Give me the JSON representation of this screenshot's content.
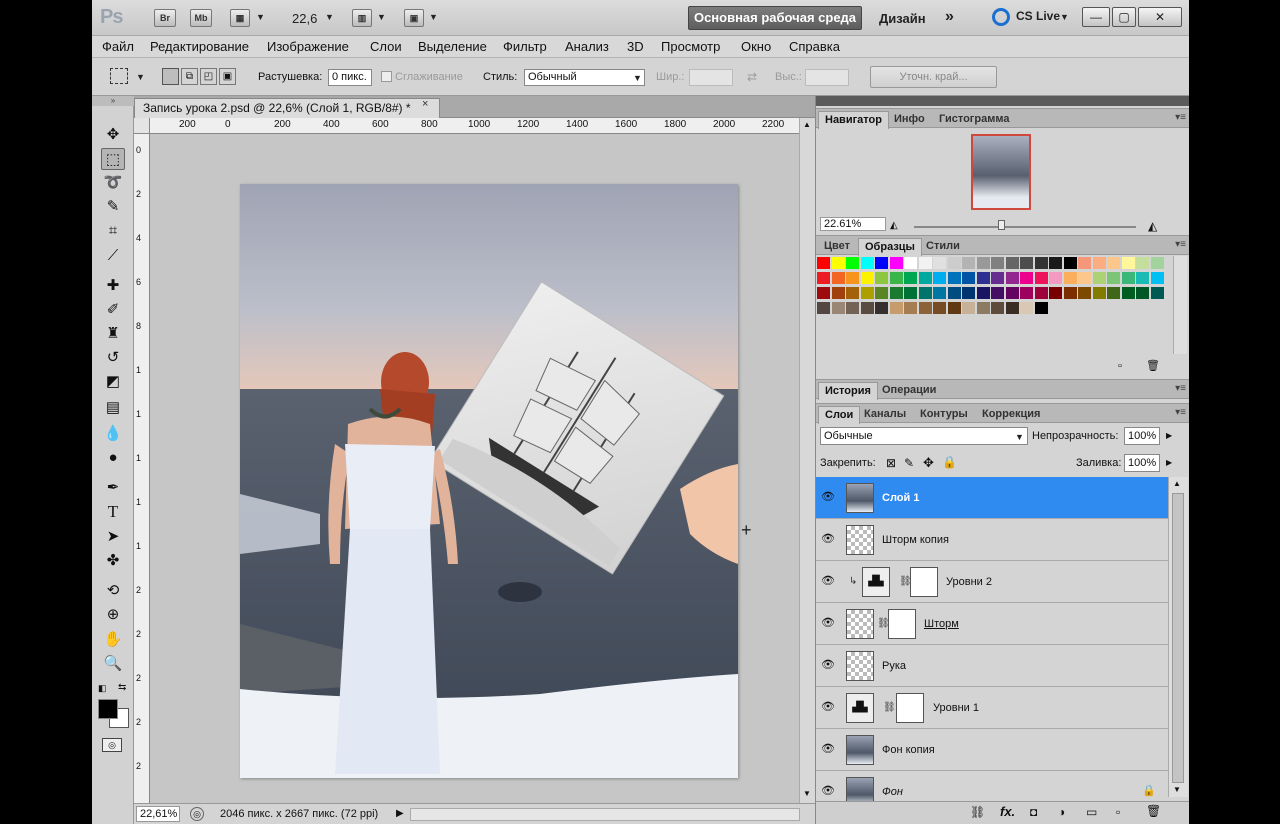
{
  "app": {
    "logo": "Ps",
    "bridge": "Br",
    "minibridge": "Mb",
    "zoom_value": "22,6",
    "workspace_active": "Основная рабочая среда",
    "workspace_design": "Дизайн",
    "workspace_more": "»",
    "cs_live": "CS Live",
    "win_min": "—",
    "win_max": "▢",
    "win_close": "✕"
  },
  "menu": [
    "Файл",
    "Редактирование",
    "Изображение",
    "Слои",
    "Выделение",
    "Фильтр",
    "Анализ",
    "3D",
    "Просмотр",
    "Окно",
    "Справка"
  ],
  "options": {
    "feather_label": "Растушевка:",
    "feather_value": "0 пикс.",
    "antialias_label": "Сглаживание",
    "style_label": "Стиль:",
    "style_value": "Обычный",
    "width_label": "Шир.:",
    "height_label": "Выс.:",
    "refine_edge": "Уточн. край..."
  },
  "document": {
    "tab_title": "Запись урока 2.psd @ 22,6% (Слой 1, RGB/8#) *",
    "tab_close": "×",
    "ruler_h": [
      "200",
      "0",
      "200",
      "400",
      "600",
      "800",
      "1000",
      "1200",
      "1400",
      "1600",
      "1800",
      "2000",
      "2200"
    ],
    "ruler_v": [
      "0",
      "2",
      "4",
      "6",
      "8",
      "1",
      "1",
      "1",
      "1",
      "1",
      "2",
      "2",
      "2",
      "2",
      "2"
    ]
  },
  "status": {
    "zoom": "22,61%",
    "info": "2046 пикс. x 2667 пикс. (72 ppi)"
  },
  "panels": {
    "nav_tabs": [
      "Навигатор",
      "Инфо",
      "Гистограмма"
    ],
    "nav_zoom": "22.61%",
    "swatch_tabs": [
      "Цвет",
      "Образцы",
      "Стили"
    ],
    "history_tabs": [
      "История",
      "Операции"
    ],
    "layer_tabs": [
      "Слои",
      "Каналы",
      "Контуры",
      "Коррекция"
    ],
    "blend_mode": "Обычные",
    "opacity_label": "Непрозрачность:",
    "opacity_value": "100%",
    "lock_label": "Закрепить:",
    "fill_label": "Заливка:",
    "fill_value": "100%",
    "layers": [
      {
        "name": "Слой 1",
        "selected": true
      },
      {
        "name": "Шторм копия"
      },
      {
        "name": "Уровни 2"
      },
      {
        "name": "Шторм"
      },
      {
        "name": "Рука"
      },
      {
        "name": "Уровни 1"
      },
      {
        "name": "Фон копия"
      },
      {
        "name": "Фон"
      }
    ]
  },
  "colors": {
    "selection": "#2f8bf0",
    "workspace_btn": "#666666"
  }
}
